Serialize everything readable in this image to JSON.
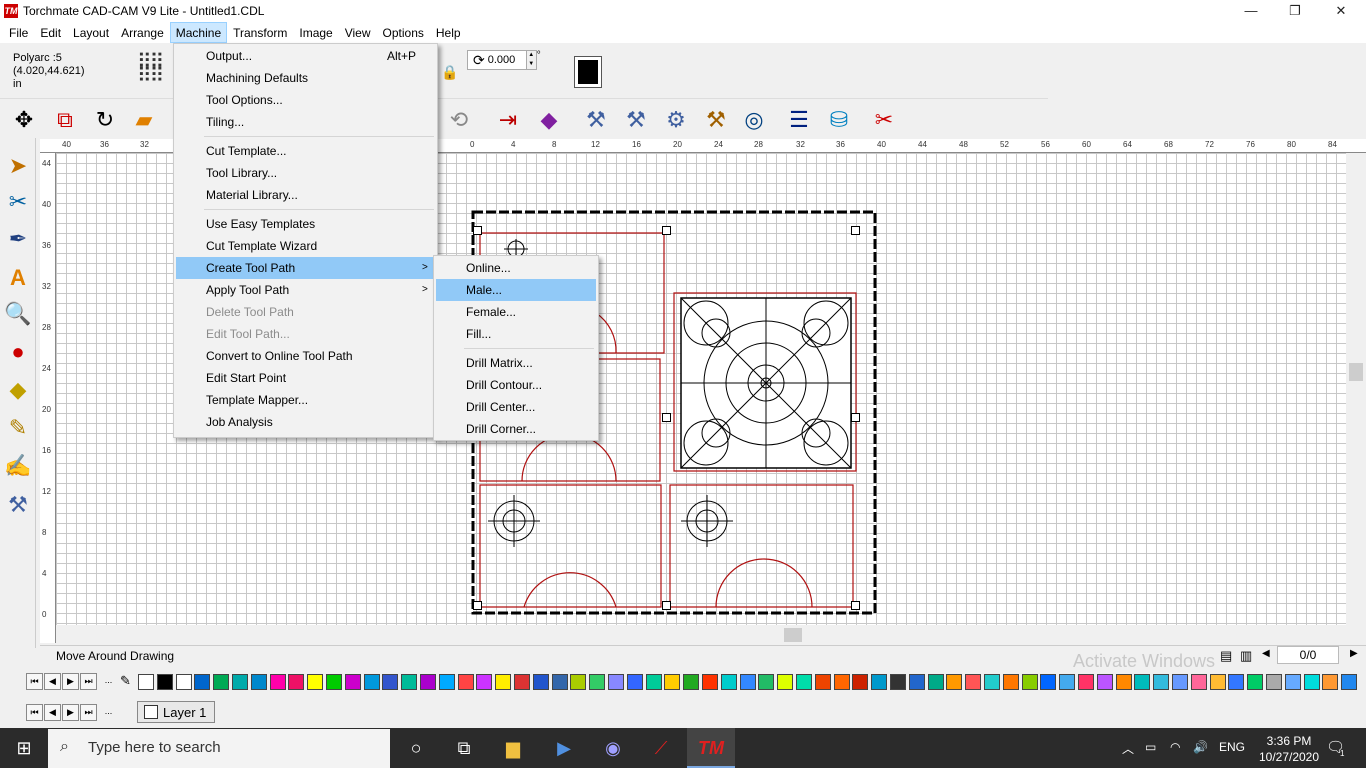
{
  "window": {
    "title": "Torchmate CAD-CAM V9 Lite - Untitled1.CDL",
    "logo": "TM",
    "minimize": "—",
    "restore": "❐",
    "close": "✕"
  },
  "menubar": [
    "File",
    "Edit",
    "Layout",
    "Arrange",
    "Machine",
    "Transform",
    "Image",
    "View",
    "Options",
    "Help"
  ],
  "props": {
    "line1": "Polyarc :5",
    "line2": "(4.020,44.621)",
    "line3": "in",
    "rotation_value": "0.000",
    "rotation_unit": "°"
  },
  "machine_menu": {
    "items": [
      {
        "label": "Output...",
        "shortcut": "Alt+P"
      },
      {
        "label": "Machining Defaults"
      },
      {
        "label": "Tool Options..."
      },
      {
        "label": "Tiling..."
      },
      {
        "label": "Cut Template..."
      },
      {
        "label": "Tool Library..."
      },
      {
        "label": "Material Library..."
      },
      {
        "label": "Use Easy Templates"
      },
      {
        "label": "Cut Template Wizard"
      },
      {
        "label": "Create Tool Path"
      },
      {
        "label": "Apply Tool Path"
      },
      {
        "label": "Delete Tool Path"
      },
      {
        "label": "Edit Tool Path..."
      },
      {
        "label": "Convert to Online Tool Path"
      },
      {
        "label": "Edit Start Point"
      },
      {
        "label": "Template Mapper..."
      },
      {
        "label": "Job Analysis"
      }
    ],
    "submenu_arrow": ">"
  },
  "toolpath_submenu": {
    "items": [
      "Online...",
      "Male...",
      "Female...",
      "Fill...",
      "Drill Matrix...",
      "Drill Contour...",
      "Drill Center...",
      "Drill Corner..."
    ]
  },
  "ruler": {
    "top_labels": [
      "40",
      "36",
      "32",
      "0",
      "4",
      "8",
      "12",
      "16",
      "20",
      "24",
      "28",
      "32",
      "36",
      "40",
      "44",
      "48",
      "52",
      "56",
      "60",
      "64",
      "68",
      "72",
      "76",
      "80",
      "84"
    ],
    "left_labels": [
      "44",
      "40",
      "36",
      "32",
      "28",
      "24",
      "20",
      "16",
      "12",
      "8",
      "4",
      "0"
    ]
  },
  "status": {
    "text": "Move Around Drawing",
    "page": "0/0",
    "watermark": "Activate Windows"
  },
  "palette": {
    "nav": [
      "⏮",
      "◀",
      "▶",
      "⏭",
      "..."
    ],
    "colors": [
      "#ffffff",
      "#000000",
      "#ffffff",
      "#0066cc",
      "#00aa55",
      "#00aaaa",
      "#0088cc",
      "#ff00aa",
      "#ee1166",
      "#ffff00",
      "#00cc00",
      "#cc00cc",
      "#0099dd",
      "#3355cc",
      "#00bb99",
      "#aa00cc",
      "#00aaff",
      "#ff4444",
      "#cc33ff",
      "#ffee00",
      "#dd3333",
      "#2255cc",
      "#3366aa",
      "#aacc00",
      "#33cc66",
      "#8888ff",
      "#3366ff",
      "#00cc99",
      "#ffcc00",
      "#22aa22",
      "#ff3300",
      "#00cccc",
      "#3388ff",
      "#22bb66",
      "#ddff00",
      "#00ddaa",
      "#ee4400",
      "#ff6600",
      "#cc2200",
      "#0099cc",
      "#333333",
      "#2266cc",
      "#00aa88",
      "#ff9900",
      "#ff5555",
      "#22cccc",
      "#ff7700",
      "#88cc00",
      "#0066ff",
      "#44aaee",
      "#ff3366",
      "#bb55ff",
      "#ff8800",
      "#00bbbb",
      "#33bbdd",
      "#6699ff",
      "#ff6699",
      "#ffbb33",
      "#3377ff",
      "#00cc66",
      "#aaaaaa",
      "#66aaff",
      "#00dddd",
      "#ff9933",
      "#2288ee",
      "#44cc44",
      "#ee66ee",
      "#3399ff",
      "#66ccff"
    ]
  },
  "layer": {
    "nav": [
      "⏮",
      "◀",
      "▶",
      "⏭",
      "..."
    ],
    "name": "Layer 1"
  },
  "taskbar": {
    "search": "Type here to search",
    "lang": "ENG",
    "time": "3:36 PM",
    "date": "10/27/2020",
    "notif": "1"
  }
}
